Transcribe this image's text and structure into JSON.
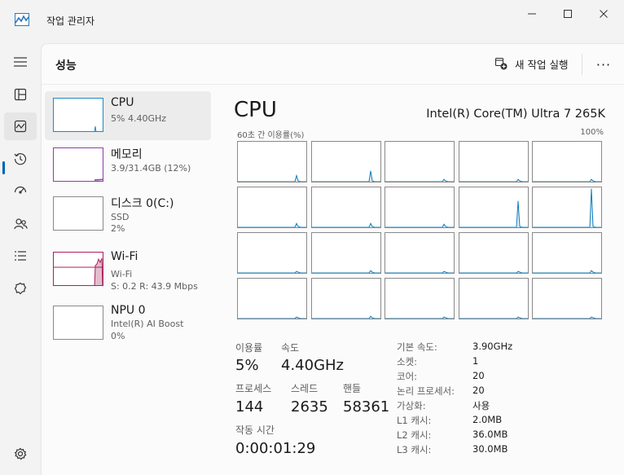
{
  "window": {
    "title": "작업 관리자"
  },
  "nav": {
    "items": [
      {
        "icon": "hamburger-icon"
      },
      {
        "icon": "processes-icon"
      },
      {
        "icon": "performance-icon"
      },
      {
        "icon": "app-history-icon"
      },
      {
        "icon": "startup-apps-icon"
      },
      {
        "icon": "users-icon"
      },
      {
        "icon": "details-icon"
      },
      {
        "icon": "services-icon"
      }
    ],
    "settings_icon": "gear-icon",
    "accent": "#0063b1"
  },
  "header": {
    "title": "성능",
    "new_task_label": "새 작업 실행",
    "more_label": "···"
  },
  "devices": [
    {
      "name": "CPU",
      "sub1": "5% 4.40GHz",
      "sub2": "",
      "color": "#1f88c9"
    },
    {
      "name": "메모리",
      "sub1": "3.9/31.4GB (12%)",
      "sub2": "",
      "color": "#8b3fa6"
    },
    {
      "name": "디스크 0(C:)",
      "sub1": "SSD",
      "sub2": "2%",
      "color": "#4fa03a"
    },
    {
      "name": "Wi-Fi",
      "sub1": "Wi-Fi",
      "sub2": "S: 0.2 R: 43.9 Mbps",
      "color": "#a7225d"
    },
    {
      "name": "NPU 0",
      "sub1": "Intel(R) AI Boost",
      "sub2": "0%",
      "color": "#1f88c9"
    }
  ],
  "cpu": {
    "title": "CPU",
    "model": "Intel(R) Core(TM) Ultra 7 265K",
    "graph_label_left": "60초 간 이용률(%)",
    "graph_label_right": "100%",
    "graph_color": "#117dbb",
    "stats": {
      "utilization_label": "이용률",
      "utilization_value": "5%",
      "speed_label": "속도",
      "speed_value": "4.40GHz",
      "processes_label": "프로세스",
      "processes_value": "144",
      "threads_label": "스레드",
      "threads_value": "2635",
      "handles_label": "핸들",
      "handles_value": "58361",
      "uptime_label": "작동 시간",
      "uptime_value": "0:00:01:29"
    },
    "specs": [
      {
        "label": "기본 속도:",
        "value": "3.90GHz"
      },
      {
        "label": "소켓:",
        "value": "1"
      },
      {
        "label": "코어:",
        "value": "20"
      },
      {
        "label": "논리 프로세서:",
        "value": "20"
      },
      {
        "label": "가상화:",
        "value": "사용"
      },
      {
        "label": "L1 캐시:",
        "value": "2.0MB"
      },
      {
        "label": "L2 캐시:",
        "value": "36.0MB"
      },
      {
        "label": "L3 캐시:",
        "value": "30.0MB"
      }
    ]
  }
}
